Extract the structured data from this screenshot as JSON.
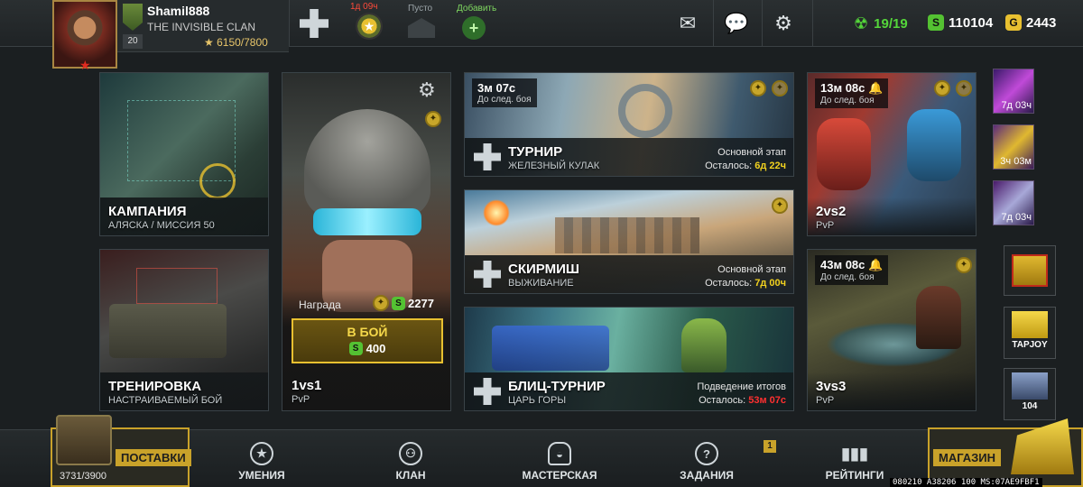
{
  "player": {
    "name": "Shamil888",
    "clan": "THE INVISIBLE CLAN",
    "level": "20",
    "xp": "6150/7800"
  },
  "header": {
    "timer_label": "1д 09ч",
    "empty_label": "Пусто",
    "add_label": "Добавить",
    "energy": "19/19",
    "silver": "110104",
    "gold": "2443"
  },
  "cards": {
    "campaign": {
      "title": "КАМПАНИЯ",
      "subtitle": "АЛЯСКА / МИССИЯ 50"
    },
    "training": {
      "title": "ТРЕНИРОВКА",
      "subtitle": "НАСТРАИВАЕМЫЙ БОЙ"
    },
    "onevone": {
      "reward_label": "Награда",
      "reward_value": "2277",
      "battle_label": "В БОЙ",
      "cost": "400",
      "title": "1vs1",
      "subtitle": "PvP"
    },
    "tournament": {
      "timer": "3м 07с",
      "timer_sub": "До след. боя",
      "title": "ТУРНИР",
      "subtitle": "ЖЕЛЕЗНЫЙ КУЛАК",
      "stage": "Основной этап",
      "remaining_label": "Осталось:",
      "remaining_value": "6д 22ч"
    },
    "skirmish": {
      "title": "СКИРМИШ",
      "subtitle": "ВЫЖИВАНИЕ",
      "stage": "Основной этап",
      "remaining_label": "Осталось:",
      "remaining_value": "7д 00ч"
    },
    "blitz": {
      "title": "БЛИЦ-ТУРНИР",
      "subtitle": "ЦАРЬ ГОРЫ",
      "stage": "Подведение итогов",
      "remaining_label": "Осталось:",
      "remaining_value": "53м 07с"
    },
    "twovtwo": {
      "timer": "13м 08с",
      "timer_sub": "До след. боя",
      "title": "2vs2",
      "subtitle": "PvP"
    },
    "threevthree": {
      "timer": "43м 08с",
      "timer_sub": "До след. боя",
      "title": "3vs3",
      "subtitle": "PvP"
    }
  },
  "side_offers": [
    {
      "label": "7д 03ч"
    },
    {
      "label": "3ч 03м"
    },
    {
      "label": "7д 03ч"
    }
  ],
  "side_shop": {
    "tapjoy": "TAPJOY",
    "count": "104"
  },
  "bottom_nav": {
    "supplies_label": "ПОСТАВКИ",
    "supplies_count": "3731/3900",
    "skills": "УМЕНИЯ",
    "clan": "КЛАН",
    "workshop": "МАСТЕРСКАЯ",
    "tasks": "ЗАДАНИЯ",
    "tasks_badge": "1",
    "rating": "РЕЙТИНГИ",
    "shop": "МАГАЗИН"
  },
  "debug": "080210 A38206 100 MS:07AE9FBF1",
  "colors": {
    "accent_gold": "#e8c030",
    "timer_red": "#ff3030",
    "timer_yellow": "#f2d21f",
    "energy_green": "#54d63a"
  }
}
